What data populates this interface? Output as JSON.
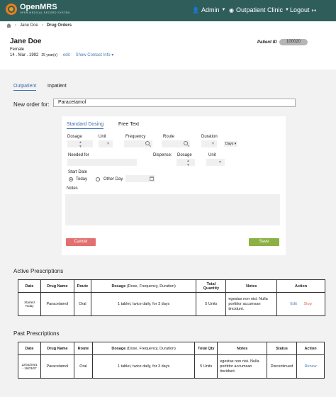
{
  "header": {
    "logo_name": "OpenMRS",
    "logo_tagline": "OPEN MEDICAL RECORD SYSTEM",
    "user_label": "Admin",
    "location_label": "Outpatient Clinic",
    "logout_label": "Logout",
    "icons": {
      "user": "user-icon",
      "location": "map-marker-icon",
      "logout": "sign-out-icon"
    }
  },
  "breadcrumb": {
    "patient": "Jane Doe",
    "current": "Drug Orders"
  },
  "patient": {
    "name": "Jane Doe",
    "gender": "Female",
    "dob": "14 . Mar . 1992",
    "age": "25 year(s)",
    "edit_link": "edit",
    "contact_link": "Show Contact Info",
    "id_label": "Patient ID",
    "id_value": "100020"
  },
  "tabs": {
    "outpatient": "Outpatient",
    "inpatient": "Inpatient"
  },
  "new_order": {
    "label": "New order for:",
    "value": "Paracetamol"
  },
  "form": {
    "tab_standard": "Standard Dosing",
    "tab_free": "Free Text",
    "dosage": "Dosage",
    "unit": "Unit",
    "frequency": "Frequency",
    "route": "Route",
    "duration": "Duration",
    "duration_unit": "Days",
    "needed_for": "Needed for",
    "dispense": "Dispense:",
    "dispense_dosage": "Dosage",
    "dispense_unit": "Unit",
    "start_date": "Start Date",
    "today": "Today",
    "other_day": "Other Day",
    "notes": "Notes",
    "cancel": "Cancel",
    "save": "Save"
  },
  "active": {
    "title": "Active Prescriptions",
    "headers": {
      "date": "Date",
      "drug": "Drug Name",
      "route": "Route",
      "dosage": "Dosage",
      "dosage_sub": "(Dose, Frequency, Duration)",
      "qty": "Total Quantity",
      "notes": "Notes",
      "action": "Action"
    },
    "row": {
      "date": "Started Today",
      "drug": "Paracetamol",
      "route": "Oral",
      "dosage": "1 tablet, twice daily, for 3 days",
      "qty": "5 Units",
      "notes": "egestas non nisi. Nulla porttitor accumsan tincidunt.",
      "edit": "Edit",
      "stop": "Stop"
    }
  },
  "past": {
    "title": "Past Prescriptions",
    "headers": {
      "date": "Date",
      "drug": "Drug Name",
      "route": "Route",
      "dosage": "Dosage",
      "dosage_sub": "(Dose, Frequency, Duration)",
      "qty": "Total Qty",
      "notes": "Notes",
      "status": "Status",
      "action": "Action"
    },
    "row": {
      "date": "12/03/2001 - 16/03/07",
      "drug": "Paracetamol",
      "route": "Oral",
      "dosage": "1 tablet, twice daily, for 3 days",
      "qty": "5 Units",
      "notes": "egestas non nisi. Nulla porttitor accumsan tincidunt.",
      "status": "Discontinued",
      "action": "Renew"
    }
  },
  "colors": {
    "header": "#2f5e5a",
    "accent": "#3b6fae",
    "cancel": "#e37070",
    "save": "#8cb043",
    "stop": "#e0605b"
  }
}
